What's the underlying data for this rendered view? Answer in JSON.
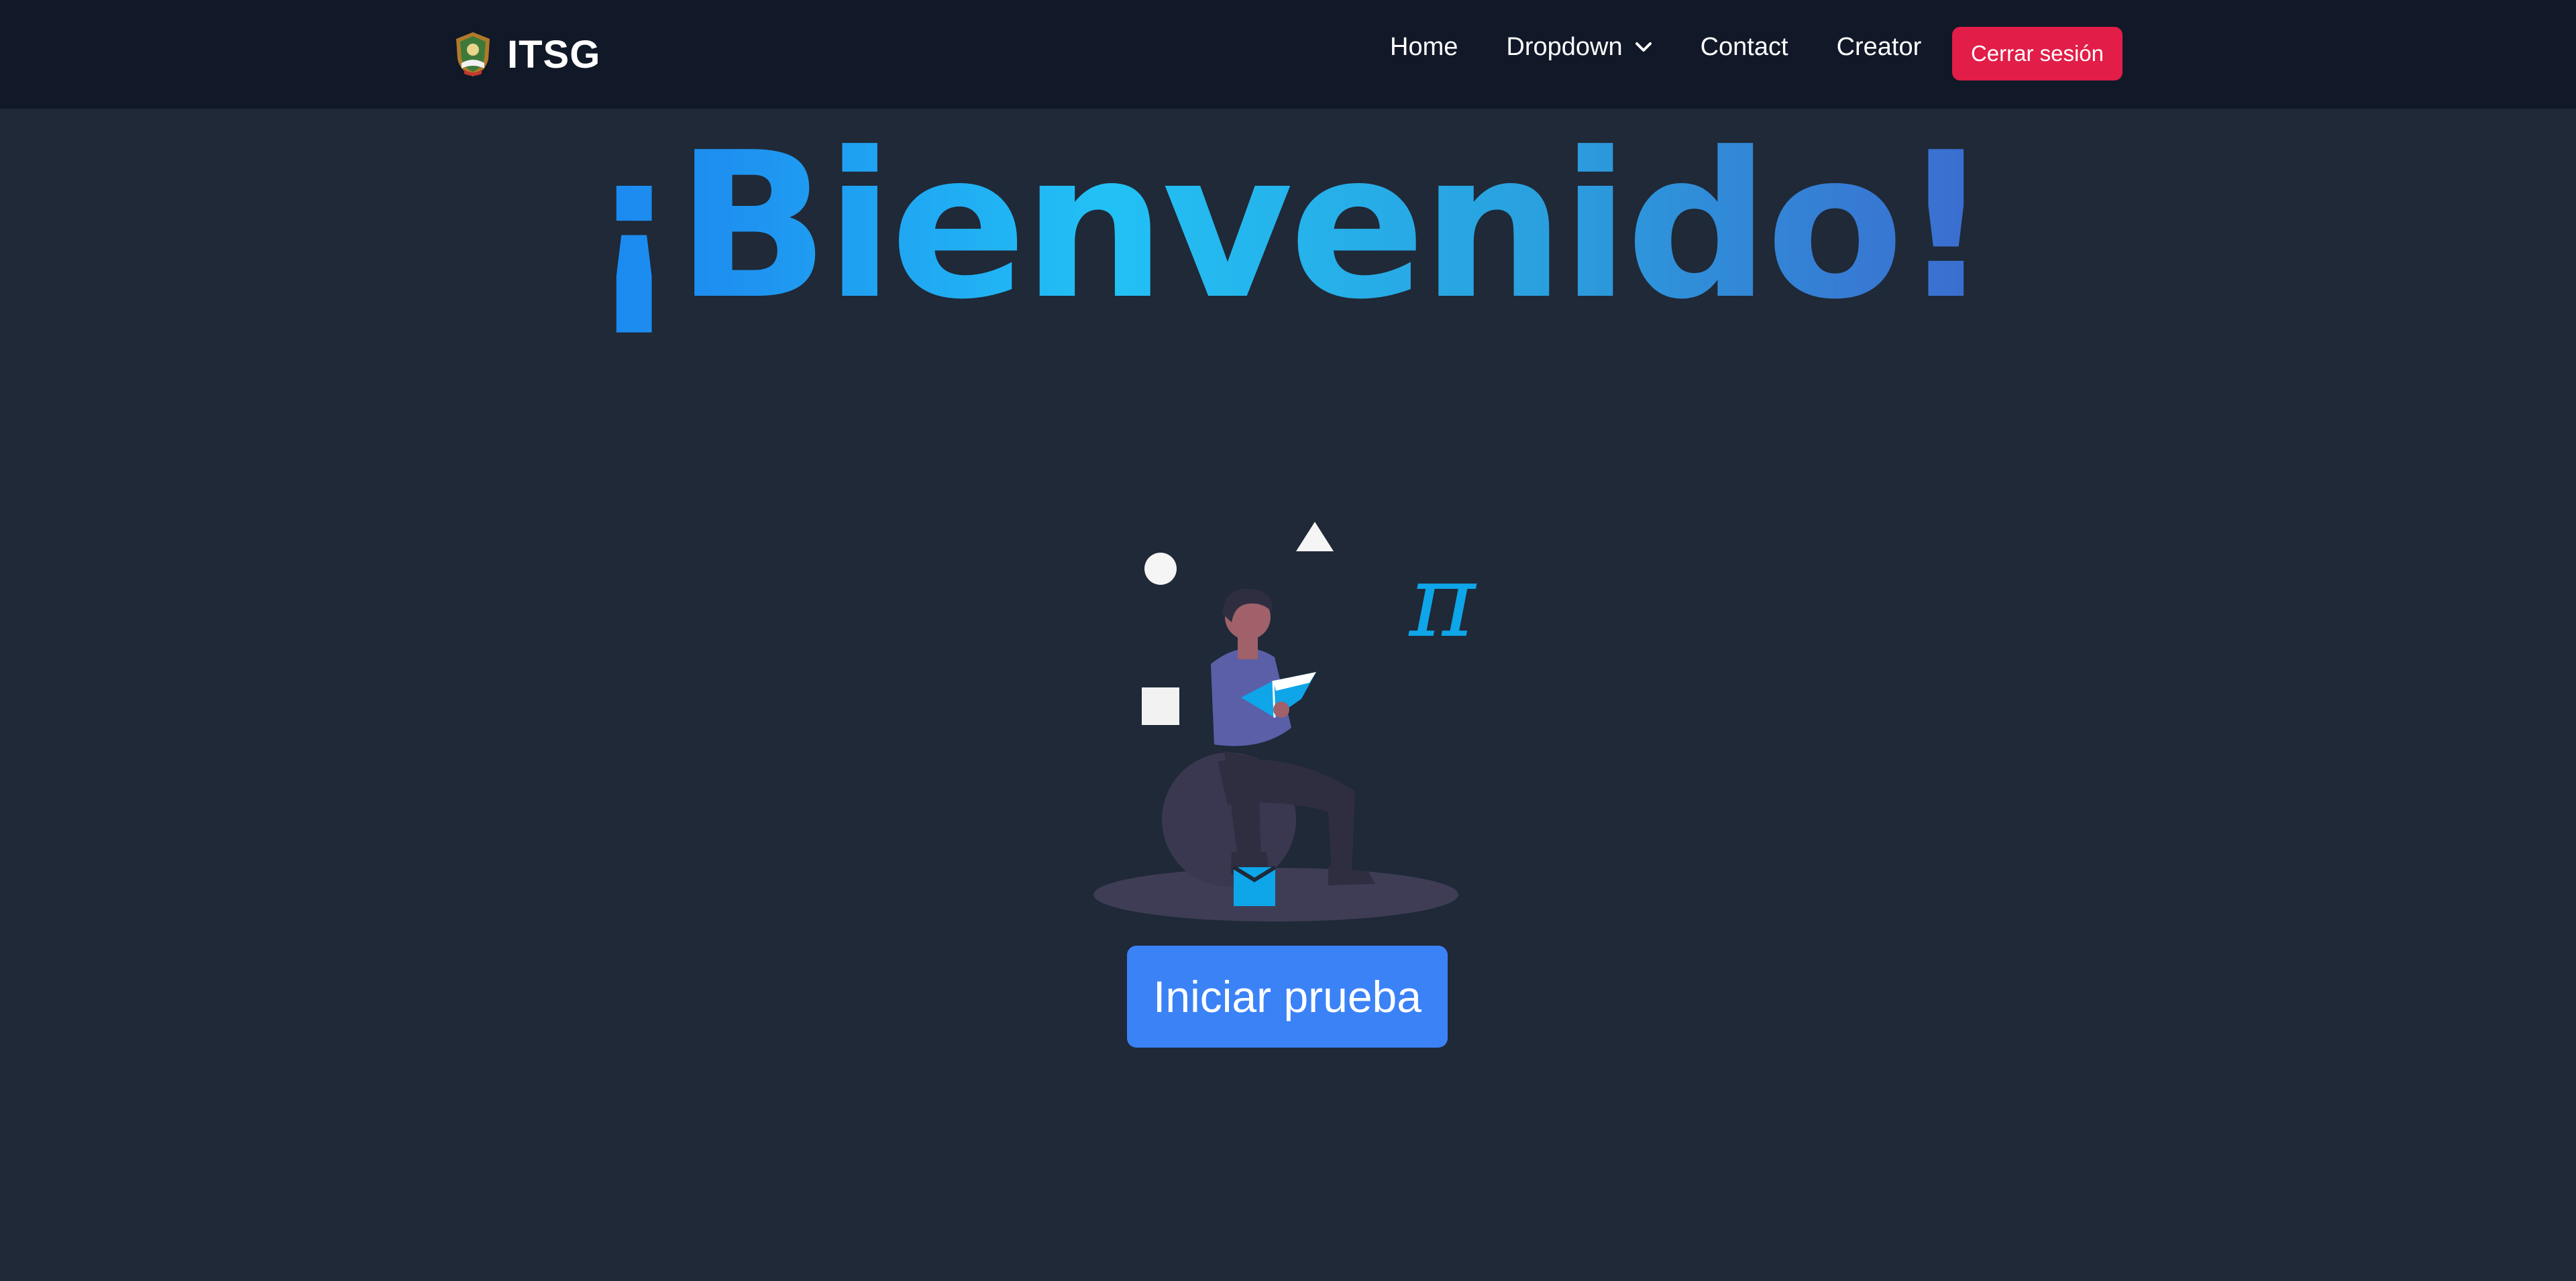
{
  "navbar": {
    "brand": "ITSG",
    "links": [
      "Home",
      "Dropdown",
      "Contact",
      "Creator"
    ],
    "logout_label": "Cerrar sesión"
  },
  "hero": {
    "title": "¡Bienvenido!",
    "pi_symbol": "π",
    "cta_label": "Iniciar prueba"
  },
  "colors": {
    "navbar_bg": "#111827",
    "page_bg": "#1f2937",
    "logout_button": "#e11d48",
    "cta_button": "#3b82f6",
    "title_gradient_start": "#0b6cf5",
    "title_gradient_mid": "#22c1f5",
    "title_gradient_end": "#5545a8"
  },
  "icons": [
    "itsg-logo-icon",
    "chevron-down-icon",
    "reading-person-illustration"
  ]
}
